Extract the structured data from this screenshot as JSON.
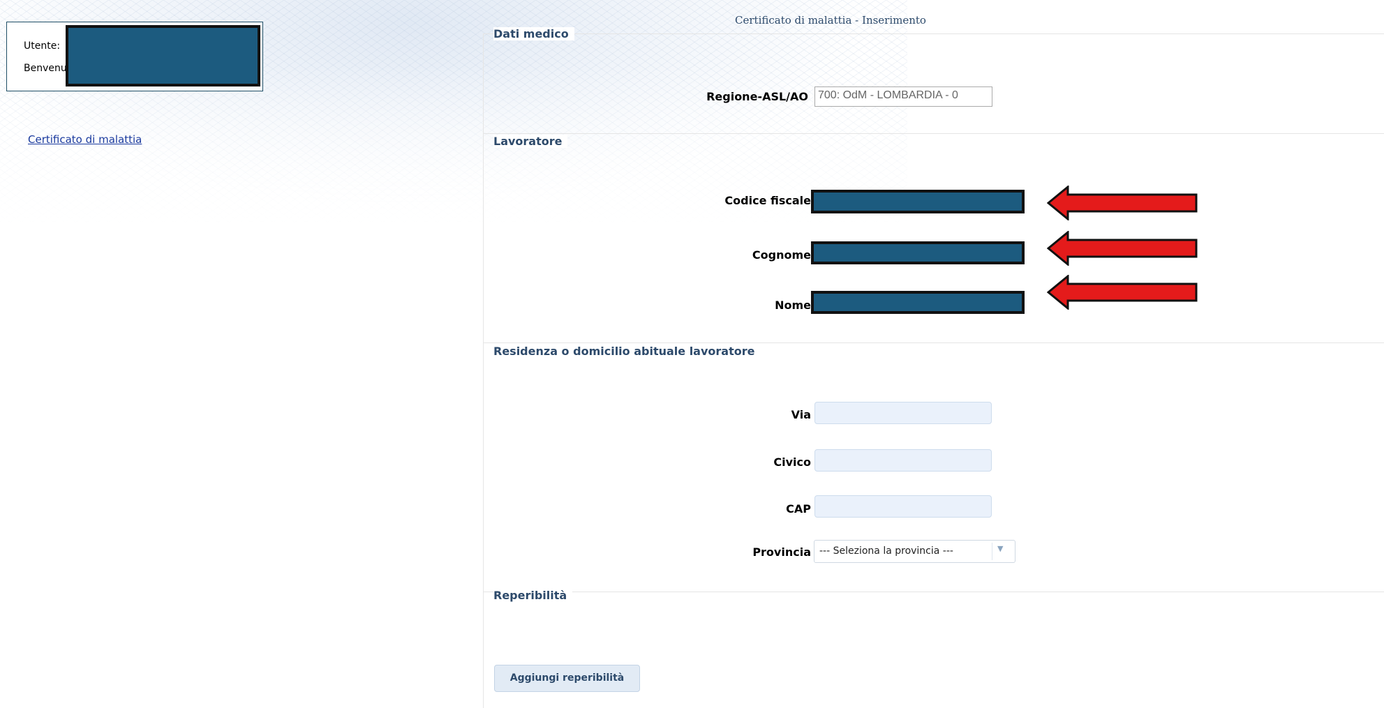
{
  "header": {
    "page_title": "Certificato di malattia - Inserimento"
  },
  "user_panel": {
    "user_label": "Utente: ",
    "welcome_label": "Benvenu"
  },
  "sidebar": {
    "certificate_link": "Certificato di malattia"
  },
  "sections": {
    "medico": {
      "legend": "Dati medico",
      "regione_label": "Regione-ASL/AO",
      "regione_value": "700: OdM - LOMBARDIA - 0"
    },
    "lavoratore": {
      "legend": "Lavoratore",
      "codice_fiscale_label": "Codice fiscale",
      "cognome_label": "Cognome",
      "nome_label": "Nome"
    },
    "residenza": {
      "legend": "Residenza o domicilio abituale lavoratore",
      "via_label": "Via",
      "civico_label": "Civico",
      "cap_label": "CAP",
      "provincia_label": "Provincia",
      "provincia_selected": "--- Seleziona la provincia ---"
    },
    "reperibilita": {
      "legend": "Reperibilità",
      "add_button": "Aggiungi reperibilità"
    }
  },
  "colors": {
    "redaction": "#1c5b7f",
    "arrow": "#e41b1b",
    "legend_text": "#2d4a6b",
    "link": "#1a3a9e",
    "input_bg": "#eaf1fb"
  }
}
